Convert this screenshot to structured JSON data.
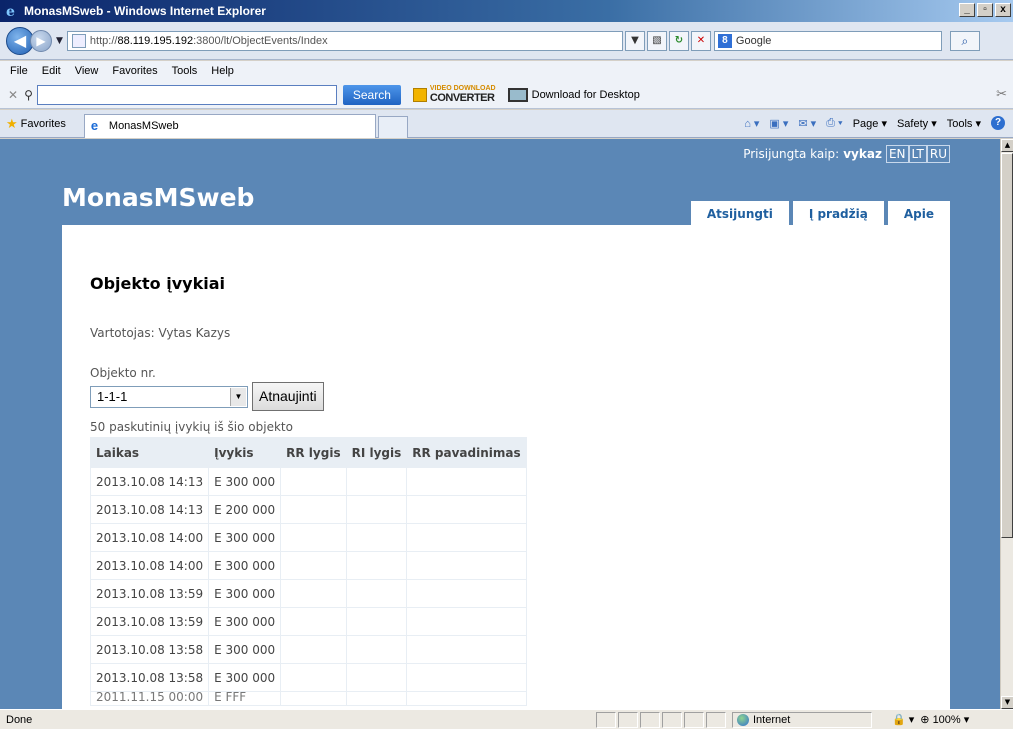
{
  "window": {
    "title": "MonasMSweb - Windows Internet Explorer",
    "controls": [
      "_",
      "▫",
      "x"
    ]
  },
  "addressbar": {
    "url_prefix": "http://",
    "url_host": "88.119.195.192",
    "url_rest": ":3800/lt/ObjectEvents/Index",
    "search_engine": "Google"
  },
  "menu": {
    "items": [
      "File",
      "Edit",
      "View",
      "Favorites",
      "Tools",
      "Help"
    ]
  },
  "toolbar": {
    "search_label": "Search",
    "vdc_top": "VIDEO DOWNLOAD",
    "vdc_bottom": "CONVERTER",
    "download_desktop": "Download for Desktop"
  },
  "favbar": {
    "favorites_label": "Favorites",
    "tab_title": "MonasMSweb",
    "page_label": "Page",
    "safety_label": "Safety",
    "tools_label": "Tools"
  },
  "site": {
    "logged_in_label": "Prisijungta kaip:",
    "username": "vykaz",
    "langs": [
      "EN",
      "LT",
      "RU"
    ],
    "title": "MonasMSweb",
    "nav": [
      "Atsijungti",
      "Į pradžią",
      "Apie"
    ]
  },
  "page": {
    "heading": "Objekto įvykiai",
    "user_line": "Vartotojas: Vytas Kazys",
    "object_label": "Objekto nr.",
    "object_selected": "1-1-1",
    "refresh_label": "Atnaujinti",
    "table_caption": "50 paskutinių įvykių iš šio objekto",
    "columns": [
      "Laikas",
      "Įvykis",
      "RR lygis",
      "RI lygis",
      "RR pavadinimas"
    ],
    "rows": [
      [
        "2013.10.08 14:13",
        "E 300 000",
        "",
        "",
        ""
      ],
      [
        "2013.10.08 14:13",
        "E 200 000",
        "",
        "",
        ""
      ],
      [
        "2013.10.08 14:00",
        "E 300 000",
        "",
        "",
        ""
      ],
      [
        "2013.10.08 14:00",
        "E 300 000",
        "",
        "",
        ""
      ],
      [
        "2013.10.08 13:59",
        "E 300 000",
        "",
        "",
        ""
      ],
      [
        "2013.10.08 13:59",
        "E 300 000",
        "",
        "",
        ""
      ],
      [
        "2013.10.08 13:58",
        "E 300 000",
        "",
        "",
        ""
      ],
      [
        "2013.10.08 13:58",
        "E 300 000",
        "",
        "",
        ""
      ]
    ],
    "partial_row": [
      "2011.11.15 00:00",
      "E FFF",
      "",
      "",
      ""
    ]
  },
  "status": {
    "text": "Done",
    "zone": "Internet",
    "zoom": "100%"
  }
}
